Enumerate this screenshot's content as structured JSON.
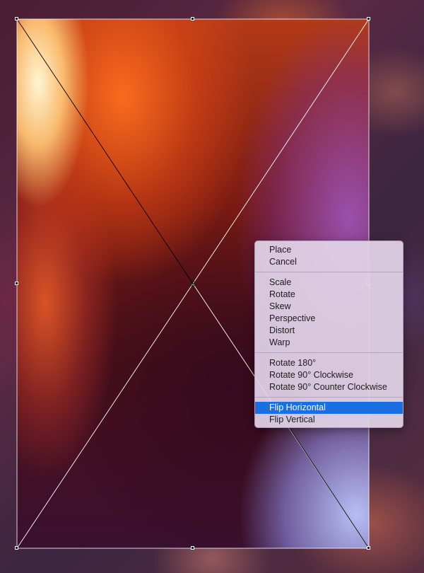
{
  "canvas": {
    "background_color": "#3a1a28",
    "bounding_box_color": "#ffffff",
    "diagonal_colors": [
      "#000000",
      "#ffffff"
    ],
    "reference_point_icon": "crosshair-icon"
  },
  "context_menu": {
    "groups": [
      {
        "items": [
          {
            "label": "Place"
          },
          {
            "label": "Cancel"
          }
        ]
      },
      {
        "items": [
          {
            "label": "Scale"
          },
          {
            "label": "Rotate"
          },
          {
            "label": "Skew"
          },
          {
            "label": "Perspective"
          },
          {
            "label": "Distort"
          },
          {
            "label": "Warp"
          }
        ]
      },
      {
        "items": [
          {
            "label": "Rotate 180°"
          },
          {
            "label": "Rotate 90° Clockwise"
          },
          {
            "label": "Rotate 90° Counter Clockwise"
          }
        ]
      },
      {
        "items": [
          {
            "label": "Flip Horizontal",
            "selected": true
          },
          {
            "label": "Flip Vertical"
          }
        ]
      }
    ],
    "highlight_color": "#1c6fe0"
  }
}
